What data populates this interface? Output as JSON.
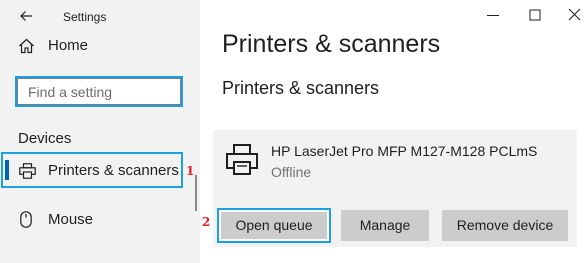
{
  "window": {
    "app_title": "Settings"
  },
  "sidebar": {
    "home_label": "Home",
    "search_placeholder": "Find a setting",
    "section_label": "Devices",
    "items": [
      {
        "label": "Printers & scanners",
        "icon": "printer-icon",
        "selected": true
      },
      {
        "label": "Mouse",
        "icon": "mouse-icon",
        "selected": false
      }
    ]
  },
  "main": {
    "page_title": "Printers & scanners",
    "sub_heading": "Printers & scanners",
    "printer": {
      "name": "HP LaserJet Pro MFP M127-M128 PCLmS",
      "status": "Offline",
      "buttons": {
        "open_queue": "Open queue",
        "manage": "Manage",
        "remove": "Remove device"
      }
    }
  },
  "annotations": {
    "marker_1": "1",
    "marker_2": "2"
  },
  "colors": {
    "highlight": "#1ba1e2",
    "accent": "#0063b1",
    "marker": "#e81e1e",
    "sidebar_bg": "#f2f2f2",
    "button_bg": "#cccccc"
  }
}
